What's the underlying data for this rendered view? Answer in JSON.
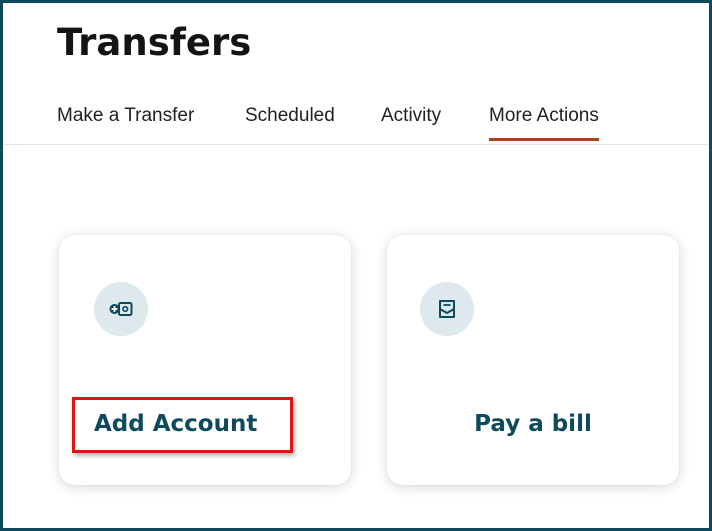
{
  "page": {
    "title": "Transfers"
  },
  "tabs": [
    {
      "label": "Make a Transfer",
      "active": false
    },
    {
      "label": "Scheduled",
      "active": false
    },
    {
      "label": "Activity",
      "active": false
    },
    {
      "label": "More Actions",
      "active": true
    }
  ],
  "cards": [
    {
      "label": "Add Account",
      "icon": "add-account-icon",
      "highlighted": true
    },
    {
      "label": "Pay a bill",
      "icon": "pay-bill-icon",
      "highlighted": false
    }
  ],
  "colors": {
    "frame_border": "#0e4a5c",
    "accent_label": "#0e4a5c",
    "active_tab_underline": "#a0471e",
    "icon_bg": "#dde9ec",
    "highlight_box": "#e01212"
  }
}
